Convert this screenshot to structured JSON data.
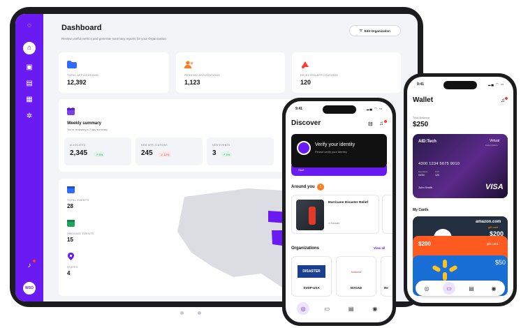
{
  "tablet": {
    "title": "Dashboard",
    "subtitle": "Review useful metrics and generate summary reports for your Organization",
    "edit_button": "Edit Organization",
    "sidebar_avatar": "WSO",
    "stats": [
      {
        "label": "TOTAL APPLICATIONS",
        "value": "12,392",
        "icon": "folder-icon",
        "color": "#2f6bff"
      },
      {
        "label": "PENDING APPLICATIONS",
        "value": "1,123",
        "icon": "users-icon",
        "color": "#ff7a1a"
      },
      {
        "label": "REJECTED APPLICATIONS",
        "value": "120",
        "icon": "rejected-icon",
        "color": "#ff3b30"
      }
    ],
    "weekly": {
      "title": "Weekly summary",
      "subtitle": "You're reviewing a 7-day summary",
      "items": [
        {
          "label": "ALLOCATED",
          "value": "2,345",
          "change": "↗ 5%",
          "trend": "up"
        },
        {
          "label": "NEW APPLICATIONS",
          "value": "245",
          "change": "↙ 12%",
          "trend": "down"
        },
        {
          "label": "NEW EVENTS",
          "value": "3",
          "change": "↗ 5%",
          "trend": "up"
        }
      ]
    },
    "events": [
      {
        "label": "TOTAL EVENTS",
        "value": "28"
      },
      {
        "label": "ONGOING EVENTS",
        "value": "15"
      },
      {
        "label": "STATES",
        "value": "4"
      }
    ]
  },
  "discover_phone": {
    "time": "9:41",
    "title": "Discover",
    "verify_title": "Verify your identity",
    "verify_sub": "Please verify your identity",
    "verify_footer": "Start",
    "around_title": "Around you",
    "around_badge": "3",
    "around_event": "Hurricane Disaster Relief",
    "around_location": "Kansas",
    "orgs_title": "Organizations",
    "view_all": "View all",
    "orgs": [
      {
        "name": "SVDP-USA",
        "logo_text": "DISASTER"
      },
      {
        "name": "NVOAD",
        "logo_text": "National"
      },
      {
        "name": "He",
        "logo_text": ""
      }
    ]
  },
  "wallet_phone": {
    "time": "9:41",
    "title": "Wallet",
    "balance_label": "Total Balance",
    "balance": "$250",
    "card": {
      "issuer": "AID:Tech",
      "type": "Virtual",
      "type_sub": "Lorem Ipsum",
      "number": "4300 1234 5675 9010",
      "expiration": "04/34",
      "cvv": "123",
      "holder": "John Smith",
      "network": "VISA"
    },
    "my_cards_title": "My Cards",
    "gift_cards": [
      {
        "brand": "amazon.com",
        "sub": "gift card",
        "amount": "$200",
        "color": "#232f3e"
      },
      {
        "brand": "",
        "sub": "gift card",
        "amount": "$200",
        "color": "#ff5a1f"
      },
      {
        "brand": "",
        "sub": "",
        "amount": "$50",
        "color": "#1a6fd6"
      }
    ]
  },
  "colors": {
    "accent": "#6a1bf2",
    "bg": "#f3f4f8",
    "frame": "#1c1c1f"
  }
}
